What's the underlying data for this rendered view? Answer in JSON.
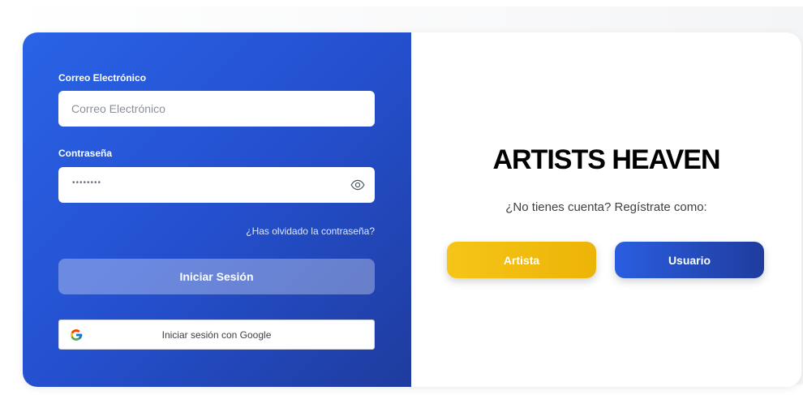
{
  "login": {
    "email_label": "Correo Electrónico",
    "email_placeholder": "Correo Electrónico",
    "password_label": "Contraseña",
    "password_masked": "••••••••",
    "forgot_link": "¿Has olvidado la contraseña?",
    "login_button": "Iniciar Sesión",
    "google_button": "Iniciar sesión con Google"
  },
  "signup": {
    "brand": "ARTISTS HEAVEN",
    "prompt": "¿No tienes cuenta? Regístrate como:",
    "artist_button": "Artista",
    "user_button": "Usuario"
  },
  "colors": {
    "panel_blue": "#2450cf",
    "accent_yellow": "#f5c518",
    "button_blue": "#1f3c9e"
  },
  "icons": {
    "password_toggle": "eye-icon",
    "google": "google-icon"
  }
}
